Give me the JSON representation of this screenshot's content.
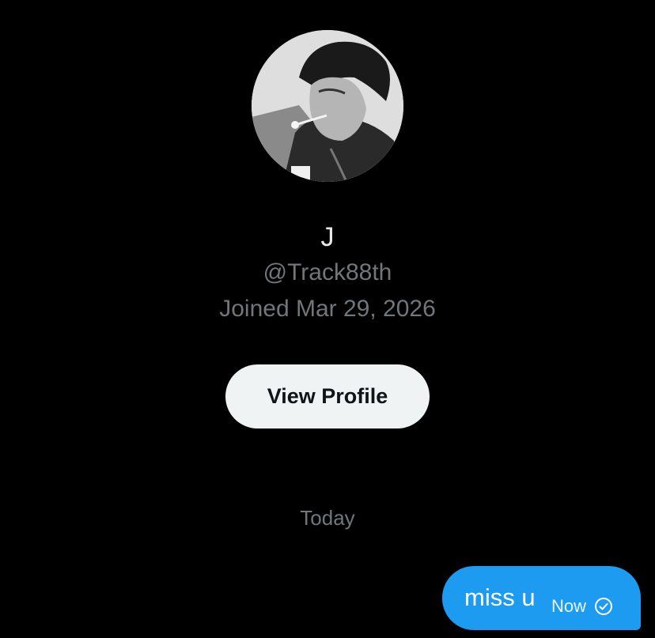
{
  "profile": {
    "display_name": "J",
    "handle": "@Track88th",
    "joined": "Joined Mar 29, 2026",
    "avatar_description": "user-avatar"
  },
  "actions": {
    "view_profile_label": "View Profile"
  },
  "conversation": {
    "day_separator": "Today",
    "messages": [
      {
        "text": "miss u",
        "time": "Now",
        "status_icon": "sent-check-circle-icon"
      }
    ]
  },
  "colors": {
    "background": "#000000",
    "primary_text": "#e7e9ea",
    "secondary_text": "#71767b",
    "button_bg": "#eff3f4",
    "button_text": "#0f1419",
    "bubble_bg": "#1d9bf0"
  }
}
